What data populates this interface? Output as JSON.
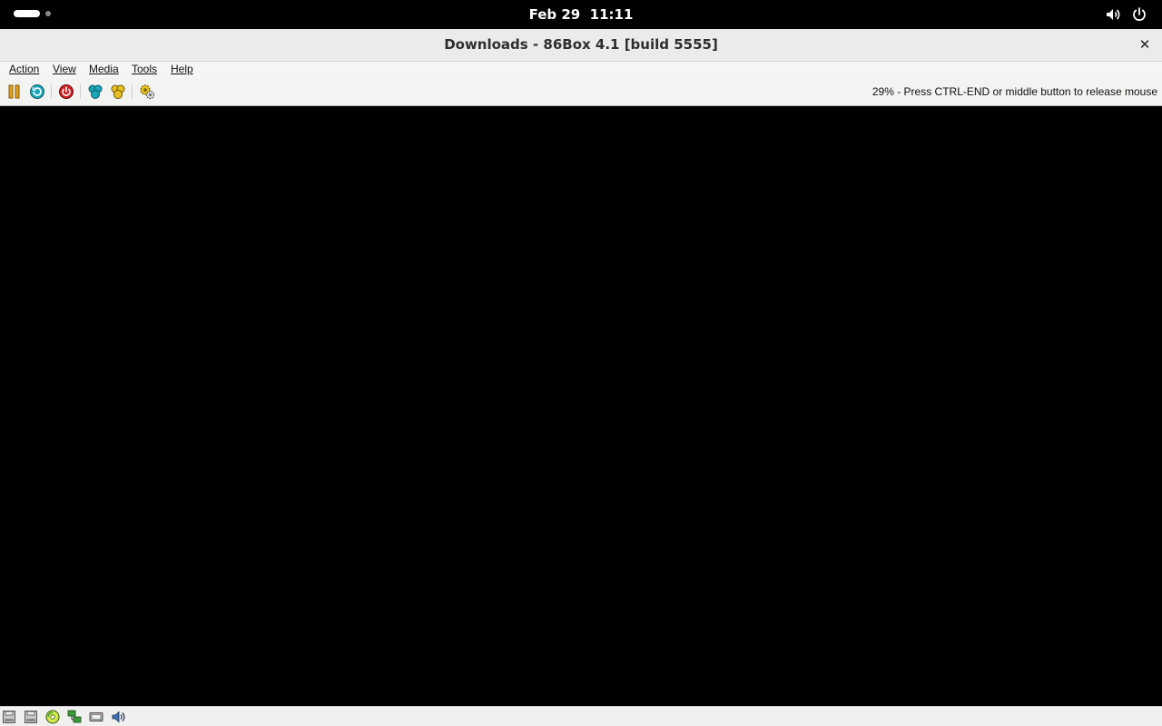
{
  "topbar": {
    "clock": "Feb 29  11:11",
    "icons": [
      "activities-indicator",
      "volume-icon",
      "power-icon"
    ]
  },
  "window": {
    "title": "Downloads - 86Box 4.1 [build 5555]",
    "close_glyph": "✕"
  },
  "menu": {
    "action": "Action",
    "view": "View",
    "media": "Media",
    "tools": "Tools",
    "help": "Help"
  },
  "toolbar": {
    "buttons": [
      "pause-icon",
      "reset-icon",
      "power-off-icon",
      "ctrl-alt-del-icon",
      "ctrl-alt-esc-icon",
      "settings-icon"
    ],
    "status_message": "29% - Press CTRL-END or middle button to release mouse"
  },
  "statusbar": {
    "icons": [
      "floppy-drive-1-icon",
      "floppy-drive-2-icon",
      "cdrom-icon",
      "network-icon",
      "hard-disk-icon",
      "sound-icon"
    ]
  },
  "colors": {
    "screen_bg": "#000000",
    "accent_teal": "#1aa5b8",
    "accent_red": "#cc1f1f",
    "accent_yellow": "#e8c020"
  }
}
